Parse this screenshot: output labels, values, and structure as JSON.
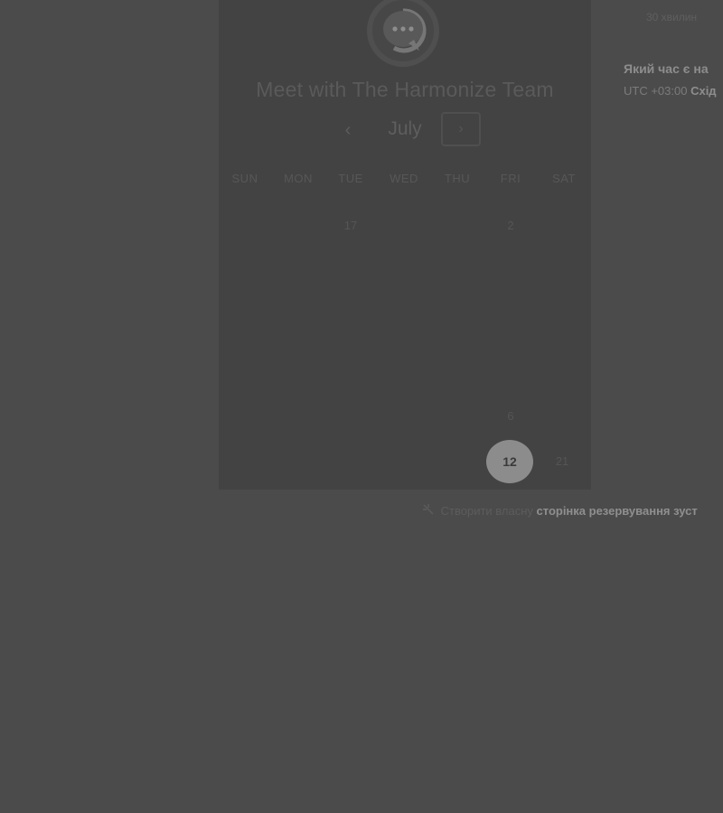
{
  "card": {
    "title": "Meet with The Harmonize Team",
    "month": "July",
    "prev_icon": "chevron-left-icon",
    "prev_label": "‹",
    "next_icon": "chevron-right-icon",
    "next_label": "›",
    "weekdays": [
      "SUN",
      "MON",
      "TUE",
      "WED",
      "THU",
      "FRI",
      "SAT"
    ],
    "days": {
      "d17": "17",
      "d2": "2",
      "d6": "6",
      "d12": "12",
      "d21": "21"
    },
    "selected_day": "12"
  },
  "right_panel": {
    "duration": "30 хвилин",
    "question": "Який час є на",
    "tz_prefix": "UTC +03:00",
    "tz_name": "Схід"
  },
  "footer": {
    "icon": "sparkle-icon",
    "prefix": "Створити власну",
    "link": "сторінка резервування зуст"
  },
  "colors": {
    "page_bg": "#4b4b4b",
    "card_bg": "#434343",
    "selected_bg": "#8c8c8c"
  }
}
